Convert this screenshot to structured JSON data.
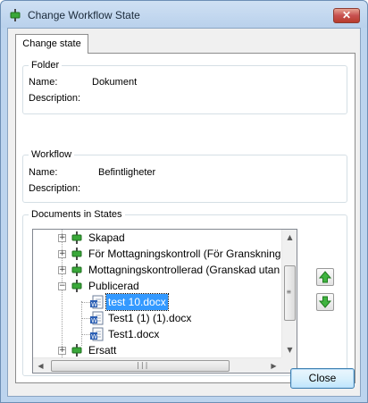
{
  "window": {
    "title": "Change Workflow State",
    "close_glyph": "✕"
  },
  "tab": {
    "label": "Change state"
  },
  "folder": {
    "legend": "Folder",
    "name_label": "Name:",
    "name_value": "Dokument",
    "description_label": "Description:",
    "description_value": ""
  },
  "workflow": {
    "legend": "Workflow",
    "name_label": "Name:",
    "name_value": "Befintligheter",
    "description_label": "Description:",
    "description_value": ""
  },
  "documents": {
    "legend": "Documents in States",
    "tree": [
      {
        "label": "Skapad",
        "kind": "state",
        "expander": "+"
      },
      {
        "label": "För Mottagningskontroll (För Granskning i",
        "kind": "state",
        "expander": "+"
      },
      {
        "label": "Mottagningskontrollerad (Granskad utan a",
        "kind": "state",
        "expander": "+"
      },
      {
        "label": "Publicerad",
        "kind": "state",
        "expander": "−"
      },
      {
        "label": "test 10.docx",
        "kind": "document",
        "selected": true
      },
      {
        "label": "Test1 (1) (1).docx",
        "kind": "document"
      },
      {
        "label": "Test1.docx",
        "kind": "document"
      },
      {
        "label": "Ersatt",
        "kind": "state",
        "expander": "+"
      }
    ],
    "move_up_icon": "arrow-up-icon",
    "move_down_icon": "arrow-down-icon"
  },
  "footer": {
    "close_label": "Close"
  },
  "colors": {
    "state_green": "#3aa83a",
    "selection_blue": "#3399ff",
    "arrow_green": "#2f9a2f"
  }
}
